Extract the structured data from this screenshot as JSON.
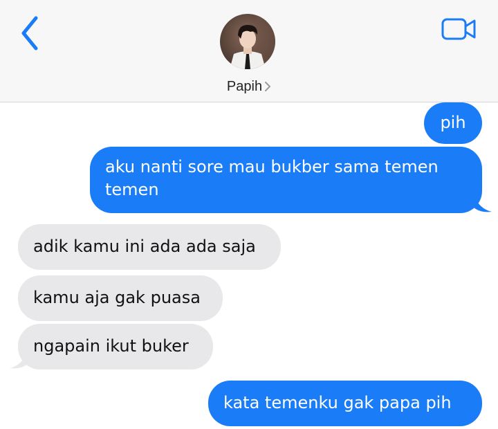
{
  "header": {
    "contact_name": "Papih",
    "avatar_alt": "Papih"
  },
  "colors": {
    "ios_blue": "#1a7cf6",
    "received_bubble": "#e8e8ea",
    "header_bg": "#f7f7f7"
  },
  "icons": {
    "back": "chevron-left-icon",
    "video": "video-camera-icon",
    "name_chevron": "chevron-right-icon"
  },
  "messages": [
    {
      "direction": "sent",
      "text": "pih"
    },
    {
      "direction": "sent",
      "text": "aku nanti sore mau bukber sama temen temen"
    },
    {
      "direction": "received",
      "text": "adik kamu ini ada ada saja"
    },
    {
      "direction": "received",
      "text": "kamu aja gak puasa"
    },
    {
      "direction": "received",
      "text": "ngapain ikut buker"
    },
    {
      "direction": "sent",
      "text": "kata temenku gak papa pih"
    }
  ]
}
